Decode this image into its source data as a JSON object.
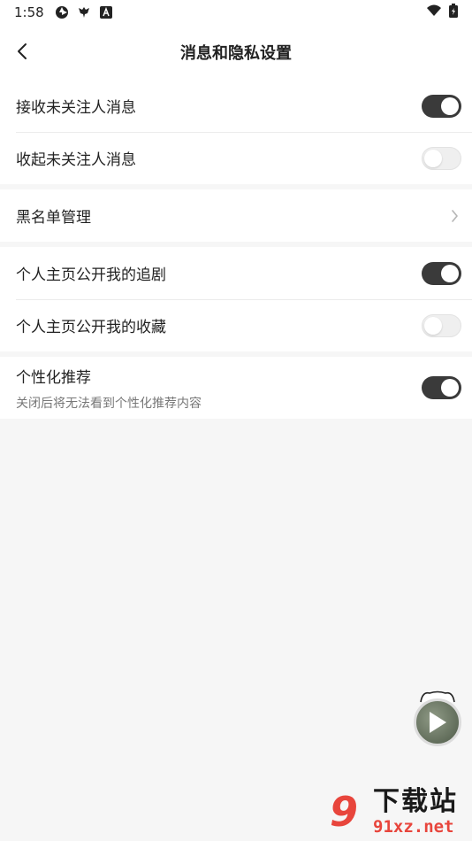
{
  "status_bar": {
    "time": "1:58"
  },
  "header": {
    "title": "消息和隐私设置"
  },
  "groups": {
    "messages": {
      "receive_unfollowed": {
        "label": "接收未关注人消息",
        "toggle": true
      },
      "collapse_unfollowed": {
        "label": "收起未关注人消息",
        "toggle": false
      }
    },
    "blacklist": {
      "label": "黑名单管理"
    },
    "privacy": {
      "public_follow_drama": {
        "label": "个人主页公开我的追剧",
        "toggle": true
      },
      "public_favorites": {
        "label": "个人主页公开我的收藏",
        "toggle": false
      },
      "personalized": {
        "label": "个性化推荐",
        "sub": "关闭后将无法看到个性化推荐内容",
        "toggle": true
      }
    }
  },
  "watermark": {
    "logo": "9",
    "text": "下载站",
    "domain": "91xz.net"
  },
  "colors": {
    "toggle_on": "#3a3a3a",
    "toggle_off": "#efefef",
    "background": "#f6f6f6",
    "watermark_red": "#e8453c"
  }
}
